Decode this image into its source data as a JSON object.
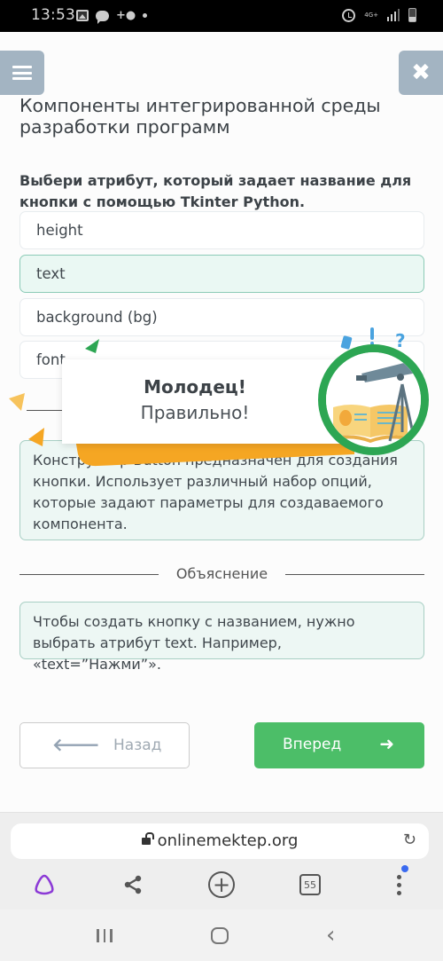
{
  "status_bar": {
    "time": "13:53",
    "network_label": "4G+"
  },
  "header": {
    "menu_icon": "hamburger-icon",
    "close_icon": "close-icon",
    "close_glyph": "✖",
    "title": "Компоненты интегрированной среды разработки программ"
  },
  "question": {
    "text": "Выбери атрибут, который задает название для кнопки с помощью Tkinter Python.",
    "options": [
      {
        "label": "height",
        "state": "default"
      },
      {
        "label": "text",
        "state": "correct"
      },
      {
        "label": "background (bg)",
        "state": "default"
      },
      {
        "label": "font",
        "state": "default"
      }
    ]
  },
  "feedback": {
    "title": "Молодец!",
    "subtitle": "Правильно!",
    "badge_icon": "telescope-book-icon",
    "colors": {
      "ribbon": "#f5a623",
      "badge_ring": "#2da653",
      "accent_green": "#2da653"
    }
  },
  "hint_box": {
    "text": "Конструктор Button предназначен для создания кнопки. Использует различный набор опций, которые задают параметры для создаваемого компонента."
  },
  "explanation": {
    "heading": "Объяснение",
    "text": "Чтобы создать кнопку с названием, нужно выбрать атрибут text. Например, «text=”Нажми”»."
  },
  "navigation": {
    "back_label": "Назад",
    "back_arrow": "🡐",
    "next_label": "Вперед",
    "next_arrow": "➜",
    "next_color": "#4cbe68"
  },
  "browser": {
    "url": "onlinemektep.org",
    "reload_glyph": "↻",
    "tabs_count": "55",
    "new_tab_glyph": "+"
  }
}
